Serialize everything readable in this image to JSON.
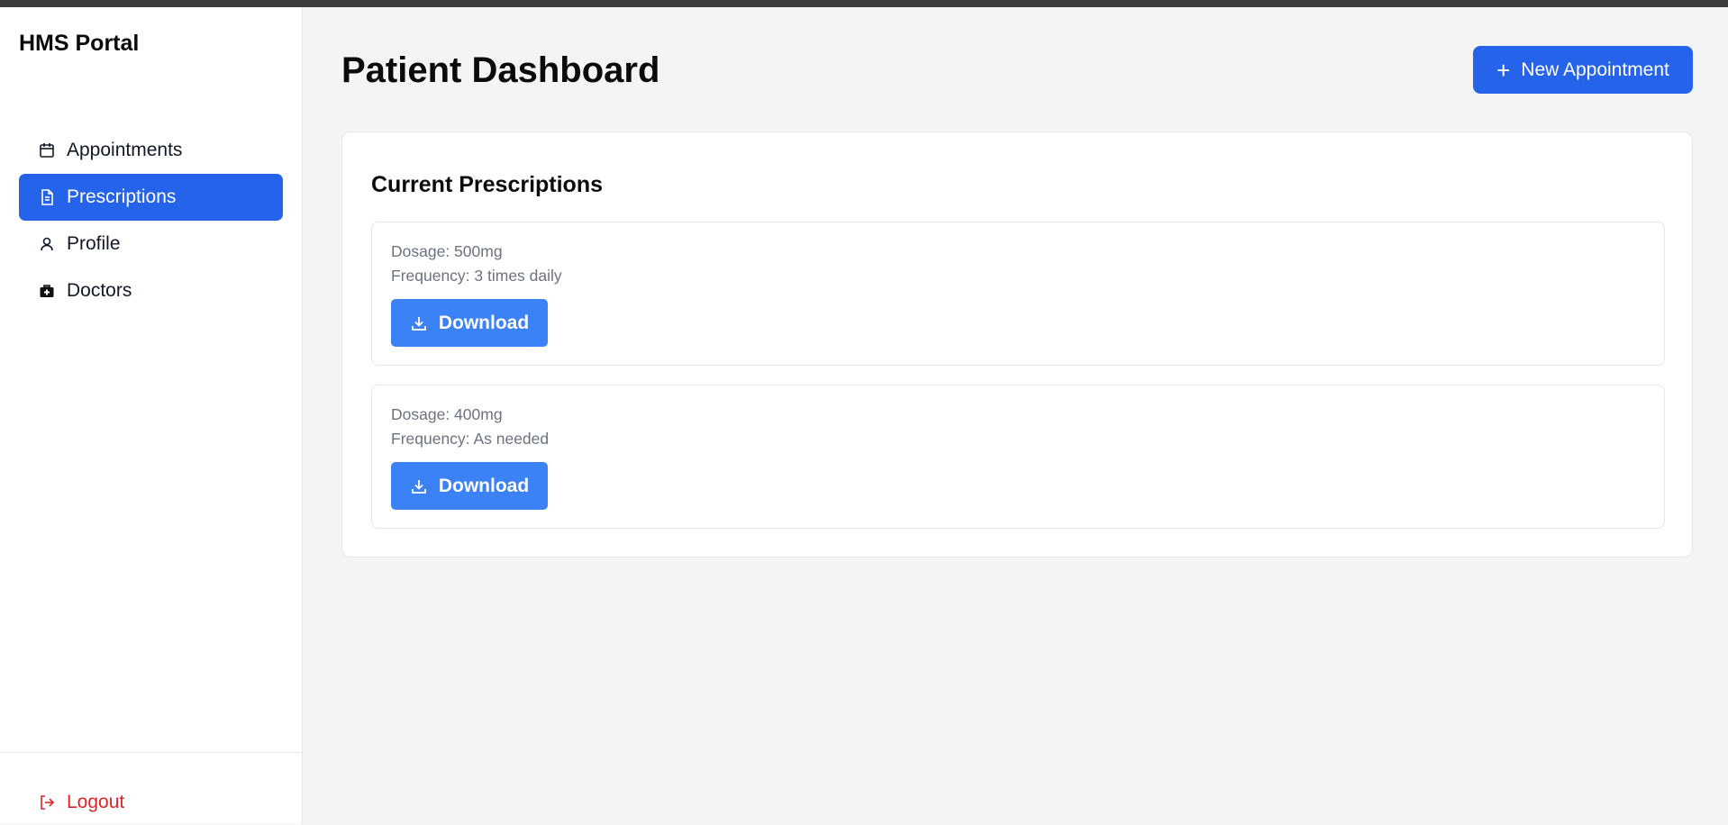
{
  "app": {
    "brand": "HMS Portal"
  },
  "sidebar": {
    "items": [
      {
        "label": "Appointments",
        "icon": "calendar-icon",
        "active": false
      },
      {
        "label": "Prescriptions",
        "icon": "document-icon",
        "active": true
      },
      {
        "label": "Profile",
        "icon": "user-icon",
        "active": false
      },
      {
        "label": "Doctors",
        "icon": "medical-kit-icon",
        "active": false
      }
    ],
    "logout_label": "Logout"
  },
  "header": {
    "title": "Patient Dashboard",
    "new_appointment_label": "New Appointment"
  },
  "prescriptions": {
    "title": "Current Prescriptions",
    "items": [
      {
        "dosage": "Dosage: 500mg",
        "frequency": "Frequency: 3 times daily",
        "download_label": "Download"
      },
      {
        "dosage": "Dosage: 400mg",
        "frequency": "Frequency: As needed",
        "download_label": "Download"
      }
    ]
  },
  "colors": {
    "primary": "#2563eb",
    "download": "#3b82f6",
    "logout": "#dc2626",
    "background": "#f3f4f6"
  }
}
